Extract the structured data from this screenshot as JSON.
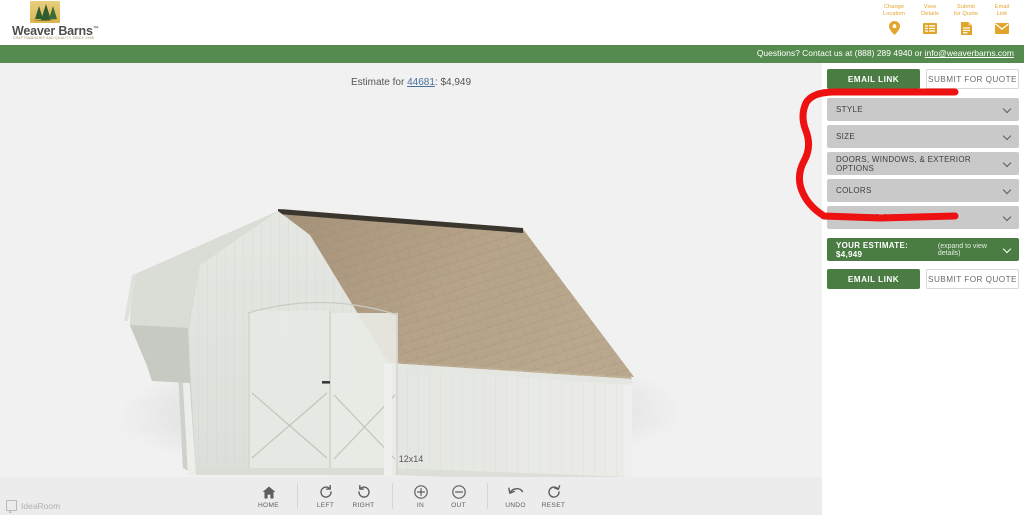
{
  "brand": {
    "name": "Weaver Barns",
    "trademark": "™",
    "tagline": "CRAFTSMANSHIP AND QUALITY SINCE 1998",
    "logo_icon": "trees-logo-icon"
  },
  "topnav": {
    "items": [
      {
        "label": "Change\nLocation",
        "icon": "map-pin-icon",
        "name": "change-location"
      },
      {
        "label": "View\nDetails",
        "icon": "list-icon",
        "name": "view-details"
      },
      {
        "label": "Submit\nfor Quote",
        "icon": "document-icon",
        "name": "submit-for-quote"
      },
      {
        "label": "Email\nLink",
        "icon": "envelope-icon",
        "name": "email-link"
      }
    ]
  },
  "contact_bar": {
    "prefix": "Questions? Contact us at ",
    "phone": "(888) 289 4940",
    "joiner": " or ",
    "email": "info@weaverbarns.com",
    "background": "#558b4e"
  },
  "viewer": {
    "estimate_prefix": "Estimate for ",
    "estimate_link": "44681",
    "estimate_separator": ": ",
    "estimate_price": "$4,949",
    "size_label": "12x14",
    "background": "#f1f1f1",
    "model": {
      "type": "gambrel-barn",
      "siding_color": "#e9eae6",
      "roof_color": "#a6937a",
      "trim_color": "#f2f3f0"
    }
  },
  "toolbar": {
    "buttons": [
      {
        "label": "HOME",
        "icon": "home-icon",
        "name": "home"
      },
      {
        "label": "LEFT",
        "icon": "rotate-left-icon",
        "name": "rotate-left"
      },
      {
        "label": "RIGHT",
        "icon": "rotate-right-icon",
        "name": "rotate-right"
      },
      {
        "label": "IN",
        "icon": "zoom-in-icon",
        "name": "zoom-in"
      },
      {
        "label": "OUT",
        "icon": "zoom-out-icon",
        "name": "zoom-out"
      },
      {
        "label": "UNDO",
        "icon": "undo-icon",
        "name": "undo"
      },
      {
        "label": "RESET",
        "icon": "reset-icon",
        "name": "reset"
      }
    ]
  },
  "watermark": {
    "label": "IdeaRoom",
    "icon": "idearoom-icon"
  },
  "panel": {
    "top_buttons": {
      "email_link": "EMAIL LINK",
      "submit_for_quote": "SUBMIT FOR QUOTE"
    },
    "bottom_buttons": {
      "email_link": "EMAIL LINK",
      "submit_for_quote": "SUBMIT FOR QUOTE"
    },
    "sections": [
      {
        "label": "STYLE",
        "name": "style"
      },
      {
        "label": "SIZE",
        "name": "size"
      },
      {
        "label": "DOORS, WINDOWS, & EXTERIOR OPTIONS",
        "name": "doors-windows-exterior-options"
      },
      {
        "label": "COLORS",
        "name": "colors"
      },
      {
        "label": "FLOORING & INTERIOR",
        "name": "flooring-interior"
      }
    ],
    "estimate_bar": {
      "label": "YOUR ESTIMATE: $4,949",
      "hint": "(expand to view details)"
    },
    "accent_green": "#4a7c43",
    "section_grey": "#c9c9c9"
  },
  "annotation": {
    "color": "#ee1111",
    "shape": "hand-drawn-bracket"
  }
}
